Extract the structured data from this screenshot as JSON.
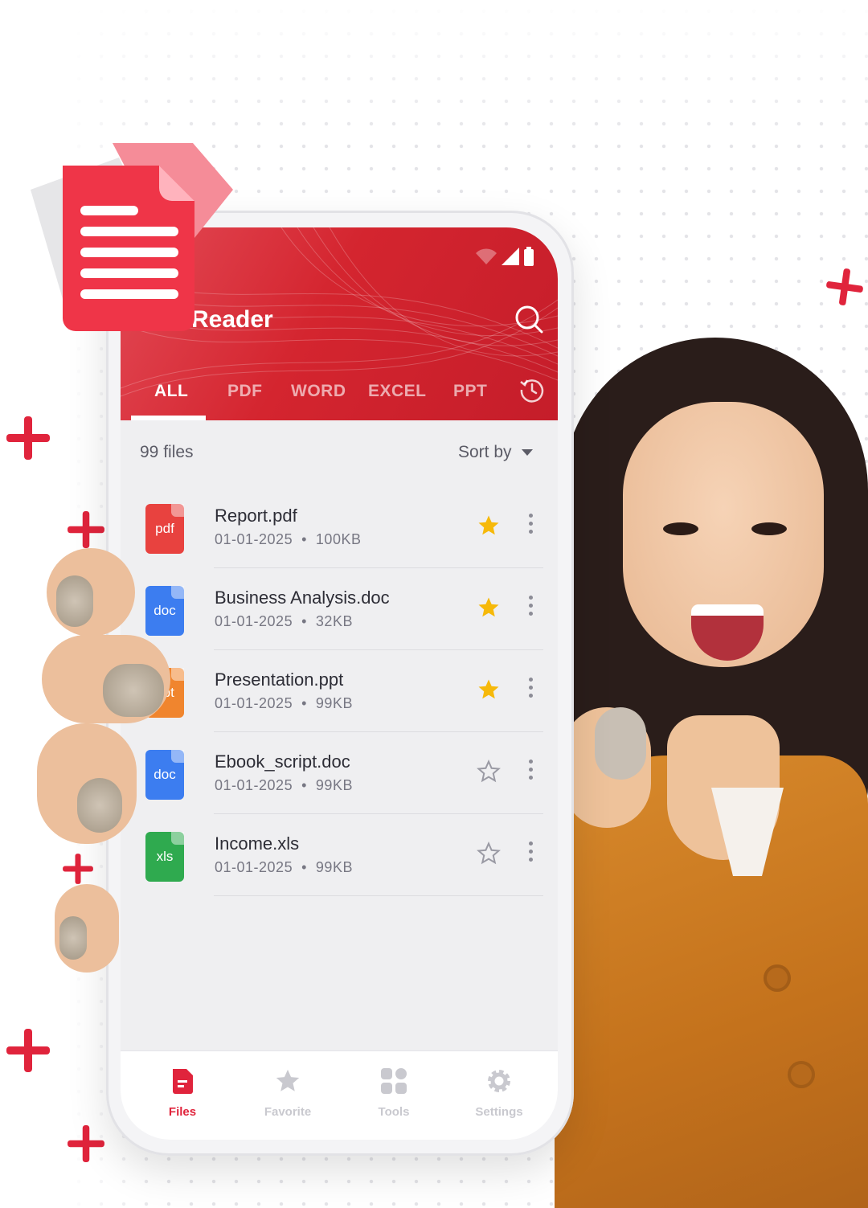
{
  "app": {
    "title": "Reader"
  },
  "tabs": [
    {
      "label": "ALL",
      "active": true
    },
    {
      "label": "PDF",
      "active": false
    },
    {
      "label": "WORD",
      "active": false
    },
    {
      "label": "EXCEL",
      "active": false
    },
    {
      "label": "PPT",
      "active": false
    }
  ],
  "list_header": {
    "count": "99 files",
    "sort_label": "Sort by"
  },
  "files": [
    {
      "name": "Report.pdf",
      "date": "01-01-2025",
      "size": "100KB",
      "type": "pdf",
      "color": "#e8423f",
      "favorite": true
    },
    {
      "name": "Business Analysis.doc",
      "date": "01-01-2025",
      "size": "32KB",
      "type": "doc",
      "color": "#3c7df0",
      "favorite": true
    },
    {
      "name": "Presentation.ppt",
      "date": "01-01-2025",
      "size": "99KB",
      "type": "ppt",
      "color": "#f0852e",
      "favorite": true
    },
    {
      "name": "Ebook_script.doc",
      "date": "01-01-2025",
      "size": "99KB",
      "type": "doc",
      "color": "#3c7df0",
      "favorite": false
    },
    {
      "name": "Income.xls",
      "date": "01-01-2025",
      "size": "99KB",
      "type": "xls",
      "color": "#2faa4f",
      "favorite": false
    }
  ],
  "meta_separator": "•",
  "bottom_nav": [
    {
      "label": "Files",
      "icon": "files-icon",
      "active": true
    },
    {
      "label": "Favorite",
      "icon": "star-icon",
      "active": false
    },
    {
      "label": "Tools",
      "icon": "tools-grid-icon",
      "active": false
    },
    {
      "label": "Settings",
      "icon": "gear-icon",
      "active": false
    }
  ],
  "colors": {
    "brand": "#d4252f",
    "accent": "#e0243c",
    "star": "#f6b90a"
  }
}
